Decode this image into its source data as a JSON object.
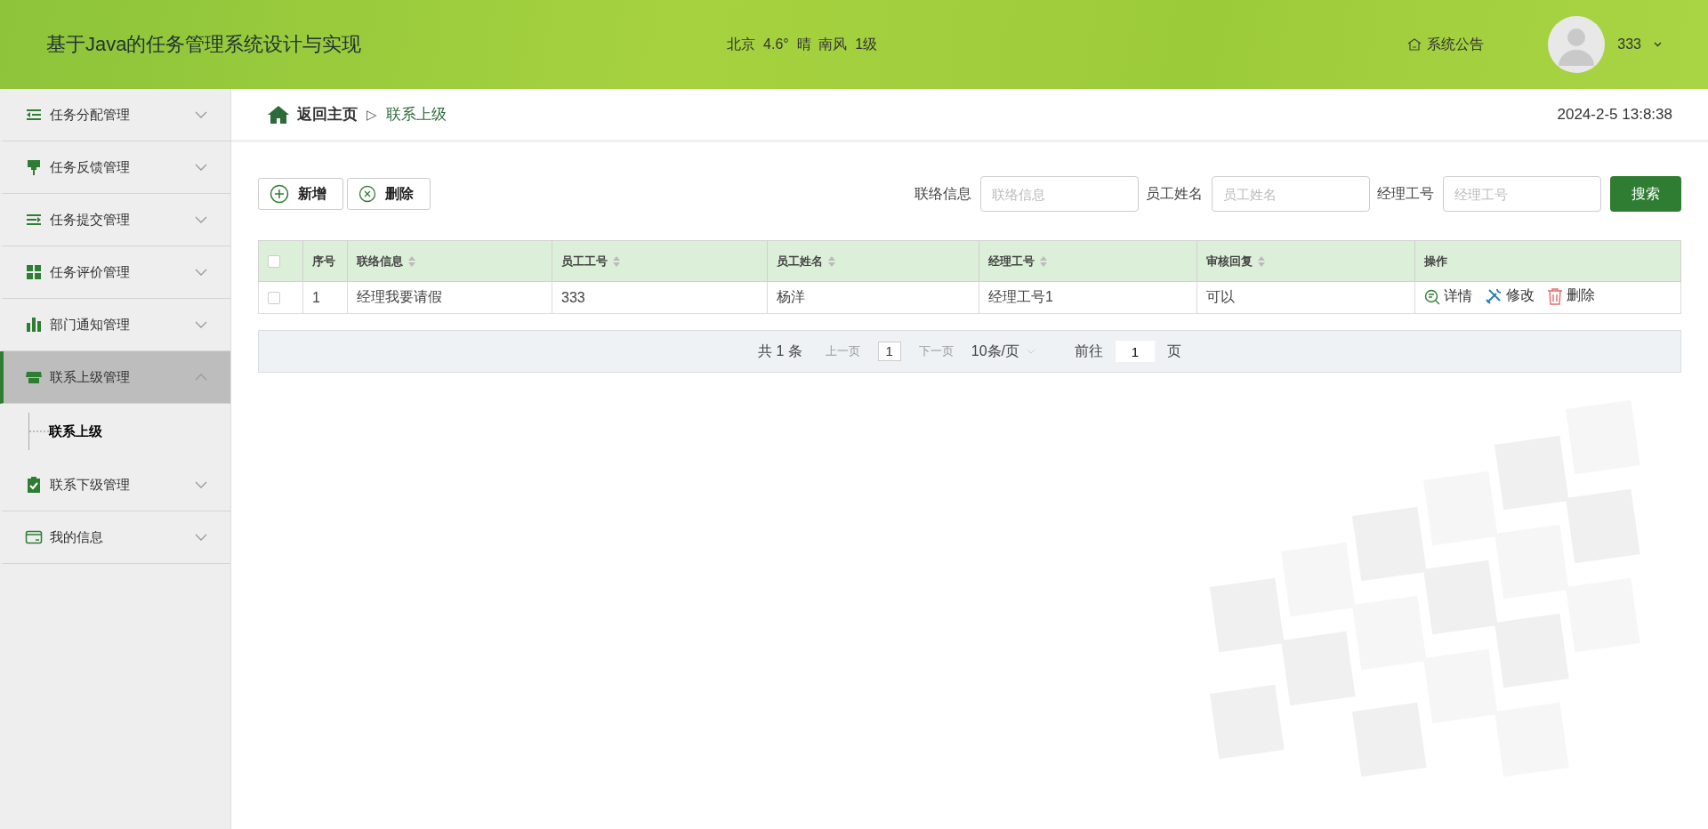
{
  "header": {
    "title": "基于Java的任务管理系统设计与实现",
    "weather": "北京  4.6°  晴  南风  1级",
    "notice": "系统公告",
    "user": "333"
  },
  "sidebar": {
    "items": [
      {
        "label": "任务分配管理",
        "expanded": false,
        "selected": false
      },
      {
        "label": "任务反馈管理",
        "expanded": false,
        "selected": false
      },
      {
        "label": "任务提交管理",
        "expanded": false,
        "selected": false
      },
      {
        "label": "任务评价管理",
        "expanded": false,
        "selected": false
      },
      {
        "label": "部门通知管理",
        "expanded": false,
        "selected": false
      },
      {
        "label": "联系上级管理",
        "expanded": true,
        "selected": true,
        "children": [
          {
            "label": "联系上级",
            "selected": true
          }
        ]
      },
      {
        "label": "联系下级管理",
        "expanded": false,
        "selected": false
      },
      {
        "label": "我的信息",
        "expanded": false,
        "selected": false
      }
    ]
  },
  "breadcrumb": {
    "home": "返回主页",
    "separator": "▷",
    "current": "联系上级",
    "datetime": "2024-2-5 13:8:38"
  },
  "toolbar": {
    "buttons": [
      {
        "label": "新增",
        "kind": "add"
      },
      {
        "label": "删除",
        "kind": "delete"
      }
    ],
    "filters": [
      {
        "label": "联络信息",
        "placeholder": "联络信息"
      },
      {
        "label": "员工姓名",
        "placeholder": "员工姓名"
      },
      {
        "label": "经理工号",
        "placeholder": "经理工号"
      }
    ],
    "search_button": "搜索"
  },
  "table": {
    "select_all": false,
    "columns": [
      {
        "label": "序号",
        "sortable": false
      },
      {
        "label": "联络信息",
        "sortable": true
      },
      {
        "label": "员工工号",
        "sortable": true
      },
      {
        "label": "员工姓名",
        "sortable": true
      },
      {
        "label": "经理工号",
        "sortable": true
      },
      {
        "label": "审核回复",
        "sortable": true
      },
      {
        "label": "操作",
        "sortable": false
      }
    ],
    "rows": [
      {
        "checked": false,
        "cells": [
          "1",
          "经理我要请假",
          "333",
          "杨洋",
          "经理工号1",
          "可以"
        ],
        "actions": [
          {
            "label": "详情",
            "kind": "detail"
          },
          {
            "label": "修改",
            "kind": "edit"
          },
          {
            "label": "删除",
            "kind": "delete"
          }
        ]
      }
    ]
  },
  "pagination": {
    "total": "共 1 条",
    "prev": {
      "label": "上一页",
      "disabled": true
    },
    "page": "1",
    "next": {
      "label": "下一页",
      "disabled": true
    },
    "page_size": "10条/页",
    "goto": "前往",
    "goto_value": "1",
    "unit": "页"
  }
}
